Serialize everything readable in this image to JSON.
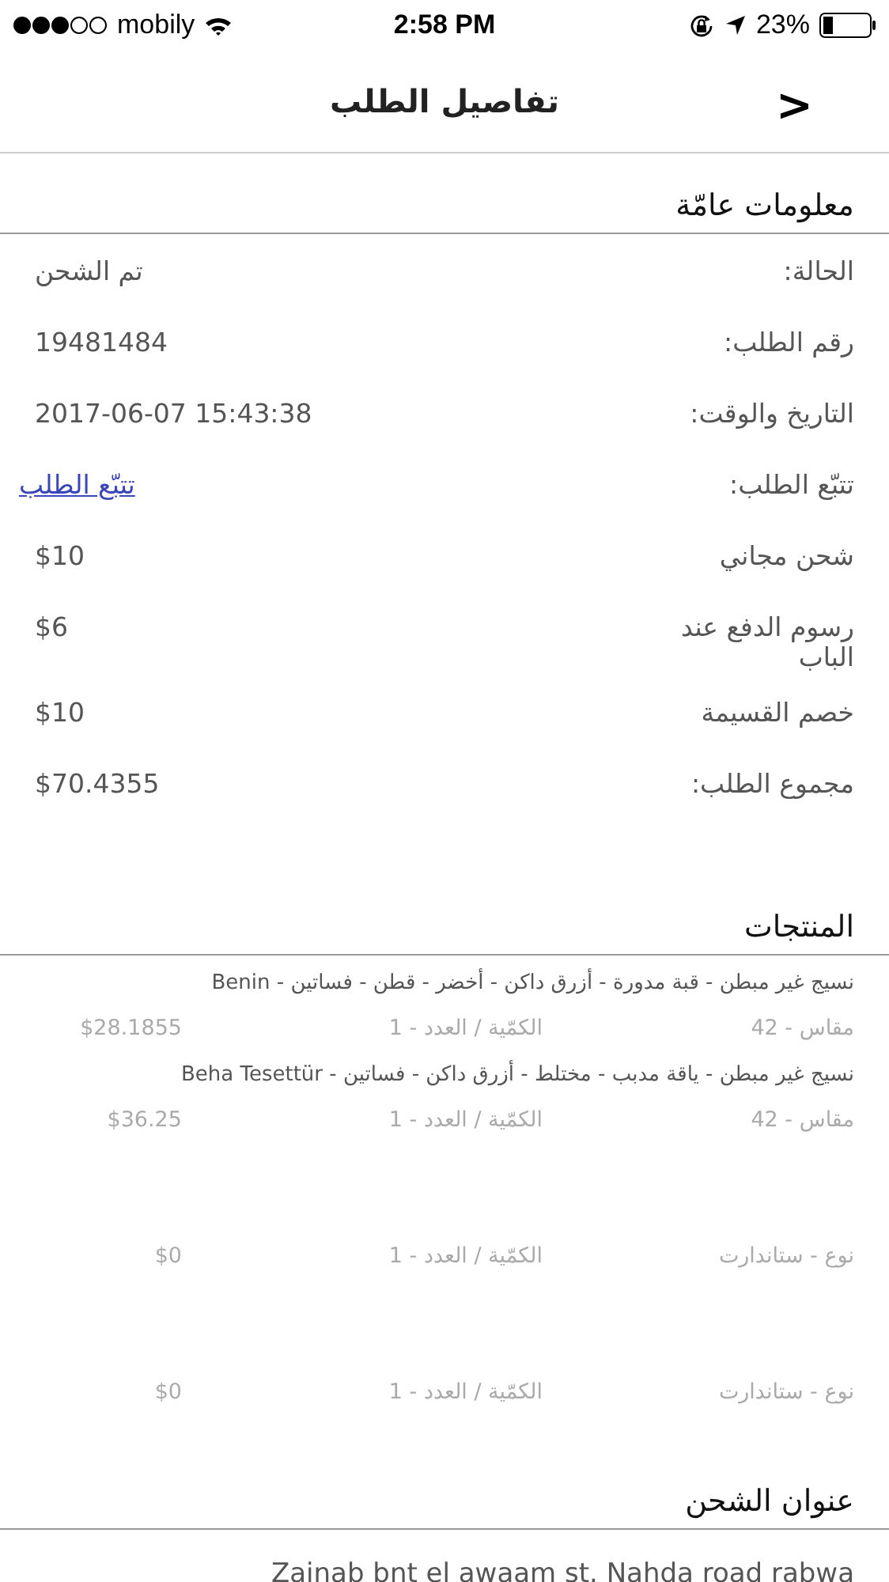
{
  "status_bar": {
    "carrier": "mobily",
    "time": "2:58 PM",
    "battery": "23%"
  },
  "nav": {
    "title": "تفاصيل الطلب",
    "back": ">"
  },
  "general": {
    "heading": "معلومات عامّة",
    "rows": [
      {
        "kind": "text",
        "label": "الحالة:",
        "value": "تم الشحن"
      },
      {
        "kind": "text",
        "label": "رقم الطلب:",
        "value": "19481484"
      },
      {
        "kind": "text",
        "label": "التاريخ والوقت:",
        "value": "2017-06-07 15:43:38"
      },
      {
        "kind": "link",
        "label": "تتبّع الطلب:",
        "value": "تتبّع الطلب"
      },
      {
        "kind": "text",
        "label": "شحن مجاني",
        "value": "$10"
      },
      {
        "kind": "text",
        "label": "رسوم الدفع عند الباب",
        "value": "$6"
      },
      {
        "kind": "text",
        "label": "خصم القسيمة",
        "value": "$10"
      },
      {
        "kind": "text",
        "label": "مجموع الطلب:",
        "value": "$70.4355"
      }
    ]
  },
  "products": {
    "heading": "المنتجات",
    "items": [
      {
        "name": "نسيج غير مبطن - قبة مدورة - أزرق داكن - أخضر - قطن - فساتين - Benin",
        "option": "مقاس - 42",
        "quantity": "الكمّية / العدد - 1",
        "price": "$28.1855"
      },
      {
        "name": "نسيج غير مبطن - ياقة  مدبب - مختلط - أزرق داكن - فساتين - Beha Tesettür",
        "option": "مقاس - 42",
        "quantity": "الكمّية / العدد - 1",
        "price": "$36.25"
      },
      {
        "option": "نوع - ستاندارت",
        "quantity": "الكمّية / العدد - 1",
        "price": "$0"
      },
      {
        "option": "نوع - ستاندارت",
        "quantity": "الكمّية / العدد - 1",
        "price": "$0"
      }
    ]
  },
  "shipping": {
    "heading": "عنوان الشحن",
    "address": "Zainab bnt el awaam st. Nahda road rabwa"
  }
}
